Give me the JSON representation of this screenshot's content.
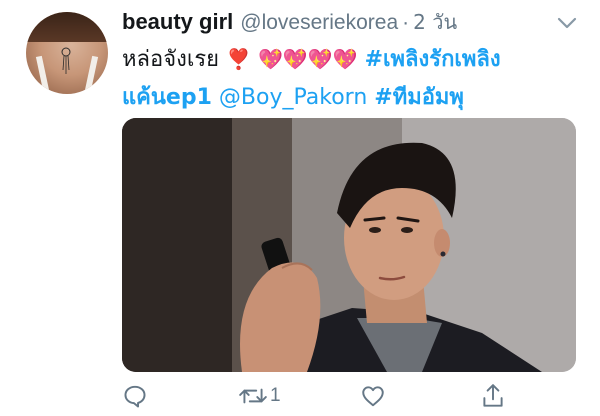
{
  "tweet": {
    "author": {
      "display_name": "beauty girl",
      "handle": "@loveseriekorea",
      "separator": "·",
      "time": "2 วัน"
    },
    "text": {
      "line1_prefix": "หล่อจังเรย",
      "emoji_exclamation": "❣️",
      "emoji_hearts": "💖💖💖💖",
      "hashtag1_part1": "#เพลิงรักเพลิง",
      "hashtag1_part2": "แค้นep1",
      "mention": "@Boy_Pakorn",
      "hashtag2": "#ทีมอัมพุ"
    },
    "actions": {
      "reply_icon": "reply-icon",
      "retweet_icon": "retweet-icon",
      "retweet_count": "1",
      "like_icon": "heart-icon",
      "share_icon": "share-icon"
    },
    "colors": {
      "link": "#1da1f2",
      "secondary": "#657786",
      "primary_text": "#14171a"
    }
  }
}
